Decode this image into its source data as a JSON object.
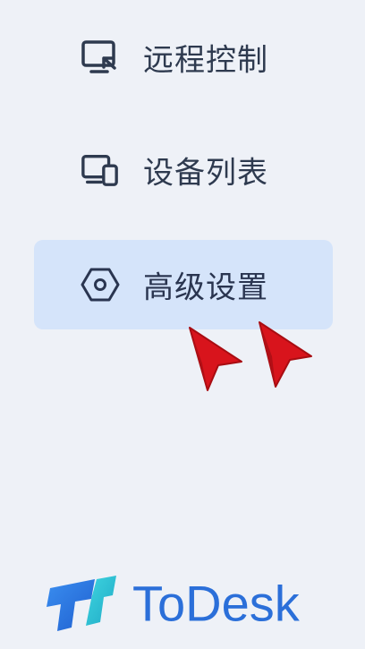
{
  "sidebar": {
    "items": [
      {
        "label": "远程控制",
        "icon": "remote-screen-icon",
        "selected": false
      },
      {
        "label": "设备列表",
        "icon": "devices-icon",
        "selected": false
      },
      {
        "label": "高级设置",
        "icon": "hex-settings-icon",
        "selected": true
      }
    ]
  },
  "brand": {
    "name": "ToDesk",
    "logo_icon": "todesk-logo-icon"
  },
  "annotations": {
    "cursor_icon": "red-arrow-cursor-icon",
    "cursor_color": "#d8141c"
  },
  "colors": {
    "background": "#eef1f7",
    "selected_background": "#d5e4fa",
    "text": "#2e3a4f",
    "brand_blue": "#2b6fd9",
    "brand_teal": "#23c3d6"
  }
}
